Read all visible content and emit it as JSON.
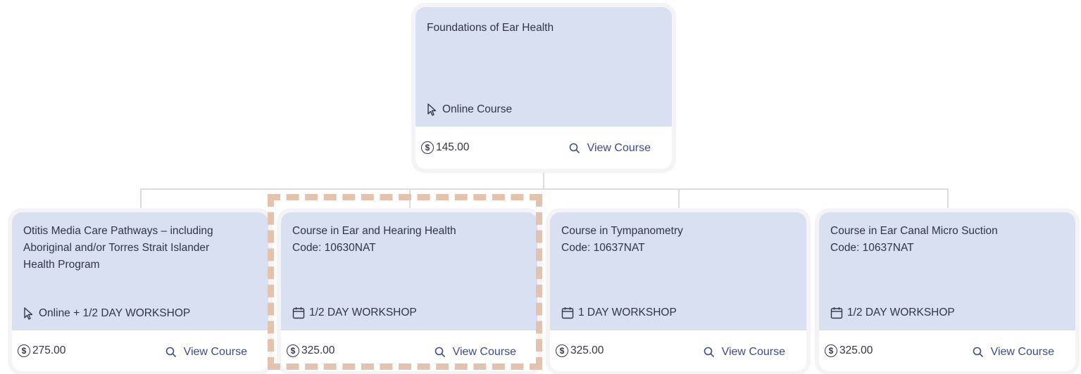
{
  "root": {
    "title": "Foundations of Ear Health",
    "mode_label": "Online Course",
    "mode_icon": "cursor-icon",
    "price": "145.00",
    "view_label": "View Course"
  },
  "children": [
    {
      "title": "Otitis Media Care Pathways – including\nAboriginal and/or Torres Strait Islander\nHealth Program",
      "mode_label": "Online + 1/2 DAY WORKSHOP",
      "mode_icon": "cursor-icon",
      "price": "275.00",
      "view_label": "View Course"
    },
    {
      "title": "Course in Ear and Hearing Health\nCode: 10630NAT",
      "mode_label": "1/2 DAY WORKSHOP",
      "mode_icon": "calendar-icon",
      "price": "325.00",
      "view_label": "View Course"
    },
    {
      "title": "Course in Tympanometry\nCode: 10637NAT",
      "mode_label": "1 DAY WORKSHOP",
      "mode_icon": "calendar-icon",
      "price": "325.00",
      "view_label": "View Course"
    },
    {
      "title": "Course in Ear Canal Micro Suction\nCode: 10637NAT",
      "mode_label": "1/2 DAY WORKSHOP",
      "mode_icon": "calendar-icon",
      "price": "325.00",
      "view_label": "View Course"
    }
  ],
  "colors": {
    "card_top": "#d8e0f2",
    "link": "#3d4a8c",
    "highlight_dash": "#e3c3ad",
    "connector": "#dcdce0"
  }
}
